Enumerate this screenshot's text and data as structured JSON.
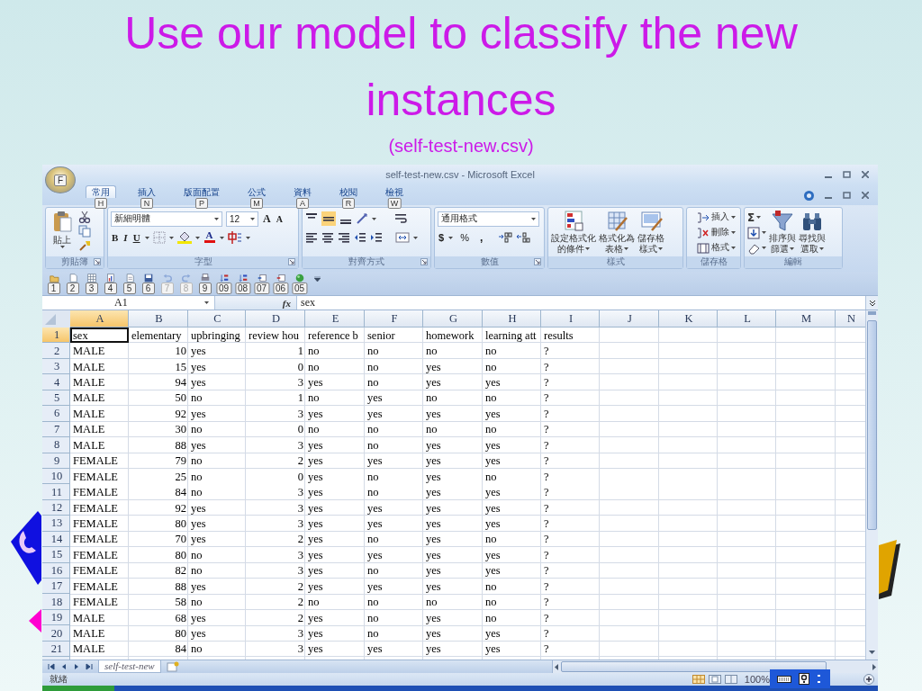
{
  "slide": {
    "title": "Use our model to classify the new instances",
    "subtitle": "(self-test-new.csv)"
  },
  "window": {
    "title": "self-test-new.csv - Microsoft Excel",
    "office_button_keytip": "F"
  },
  "ribbon_tabs": [
    {
      "label": "常用",
      "keytip": "H",
      "selected": true
    },
    {
      "label": "插入",
      "keytip": "N",
      "selected": false
    },
    {
      "label": "版面配置",
      "keytip": "P",
      "selected": false
    },
    {
      "label": "公式",
      "keytip": "M",
      "selected": false
    },
    {
      "label": "資料",
      "keytip": "A",
      "selected": false
    },
    {
      "label": "校閱",
      "keytip": "R",
      "selected": false
    },
    {
      "label": "檢視",
      "keytip": "W",
      "selected": false
    }
  ],
  "ribbon": {
    "clipboard": {
      "label": "剪貼簿",
      "paste": "貼上"
    },
    "font": {
      "label": "字型",
      "font_name": "新細明體",
      "font_size": "12",
      "grow": "A",
      "shrink": "A",
      "bold": "B",
      "italic": "I",
      "underline": "U",
      "font_color": "A"
    },
    "alignment": {
      "label": "對齊方式"
    },
    "number": {
      "label": "數值",
      "format": "通用格式",
      "currency": "$",
      "percent": "%",
      "comma": ","
    },
    "styles": {
      "label": "樣式",
      "buttons": [
        [
          "設定格式化",
          "的條件"
        ],
        [
          "格式化為",
          "表格"
        ],
        [
          "儲存格",
          "樣式"
        ]
      ]
    },
    "cells": {
      "label": "儲存格",
      "buttons": [
        "插入",
        "刪除",
        "格式"
      ]
    },
    "editing": {
      "label": "編輯",
      "sum": "Σ",
      "buttons": [
        [
          "排序與",
          "篩選"
        ],
        [
          "尋找與",
          "選取"
        ]
      ]
    }
  },
  "quick_access": [
    {
      "keytip": "1",
      "disabled": false
    },
    {
      "keytip": "2",
      "disabled": false
    },
    {
      "keytip": "3",
      "disabled": false
    },
    {
      "keytip": "4",
      "disabled": false
    },
    {
      "keytip": "5",
      "disabled": false
    },
    {
      "keytip": "6",
      "disabled": false
    },
    {
      "keytip": "7",
      "disabled": true
    },
    {
      "keytip": "8",
      "disabled": true
    },
    {
      "keytip": "9",
      "disabled": false
    },
    {
      "keytip": "09",
      "disabled": false
    },
    {
      "keytip": "08",
      "disabled": false
    },
    {
      "keytip": "07",
      "disabled": false
    },
    {
      "keytip": "06",
      "disabled": false
    },
    {
      "keytip": "05",
      "disabled": false
    }
  ],
  "formula_bar": {
    "name_box": "A1",
    "function_label": "fx",
    "value": "sex"
  },
  "sheet": {
    "columns": [
      {
        "label": "A",
        "selected": true
      },
      {
        "label": "B",
        "selected": false
      },
      {
        "label": "C",
        "selected": false
      },
      {
        "label": "D",
        "selected": false
      },
      {
        "label": "E",
        "selected": false
      },
      {
        "label": "F",
        "selected": false
      },
      {
        "label": "G",
        "selected": false
      },
      {
        "label": "H",
        "selected": false
      },
      {
        "label": "I",
        "selected": false
      },
      {
        "label": "J",
        "selected": false
      },
      {
        "label": "K",
        "selected": false
      },
      {
        "label": "L",
        "selected": false
      },
      {
        "label": "M",
        "selected": false
      },
      {
        "label": "N",
        "selected": false
      }
    ],
    "rows": [
      {
        "number": "1",
        "selected": true,
        "cells": [
          "sex",
          "elementary",
          "upbringing",
          "review hou",
          "reference b",
          "senior",
          "homework",
          "learning att",
          "results"
        ]
      },
      {
        "number": "2",
        "selected": false,
        "cells": [
          "MALE",
          "10",
          "yes",
          "1",
          "no",
          "no",
          "no",
          "no",
          "?"
        ]
      },
      {
        "number": "3",
        "selected": false,
        "cells": [
          "MALE",
          "15",
          "yes",
          "0",
          "no",
          "no",
          "yes",
          "no",
          "?"
        ]
      },
      {
        "number": "4",
        "selected": false,
        "cells": [
          "MALE",
          "94",
          "yes",
          "3",
          "yes",
          "no",
          "yes",
          "yes",
          "?"
        ]
      },
      {
        "number": "5",
        "selected": false,
        "cells": [
          "MALE",
          "50",
          "no",
          "1",
          "no",
          "yes",
          "no",
          "no",
          "?"
        ]
      },
      {
        "number": "6",
        "selected": false,
        "cells": [
          "MALE",
          "92",
          "yes",
          "3",
          "yes",
          "yes",
          "yes",
          "yes",
          "?"
        ]
      },
      {
        "number": "7",
        "selected": false,
        "cells": [
          "MALE",
          "30",
          "no",
          "0",
          "no",
          "no",
          "no",
          "no",
          "?"
        ]
      },
      {
        "number": "8",
        "selected": false,
        "cells": [
          "MALE",
          "88",
          "yes",
          "3",
          "yes",
          "no",
          "yes",
          "yes",
          "?"
        ]
      },
      {
        "number": "9",
        "selected": false,
        "cells": [
          "FEMALE",
          "79",
          "no",
          "2",
          "yes",
          "yes",
          "yes",
          "yes",
          "?"
        ]
      },
      {
        "number": "10",
        "selected": false,
        "cells": [
          "FEMALE",
          "25",
          "no",
          "0",
          "yes",
          "no",
          "yes",
          "no",
          "?"
        ]
      },
      {
        "number": "11",
        "selected": false,
        "cells": [
          "FEMALE",
          "84",
          "no",
          "3",
          "yes",
          "no",
          "yes",
          "yes",
          "?"
        ]
      },
      {
        "number": "12",
        "selected": false,
        "cells": [
          "FEMALE",
          "92",
          "yes",
          "3",
          "yes",
          "yes",
          "yes",
          "yes",
          "?"
        ]
      },
      {
        "number": "13",
        "selected": false,
        "cells": [
          "FEMALE",
          "80",
          "yes",
          "3",
          "yes",
          "yes",
          "yes",
          "yes",
          "?"
        ]
      },
      {
        "number": "14",
        "selected": false,
        "cells": [
          "FEMALE",
          "70",
          "yes",
          "2",
          "yes",
          "no",
          "yes",
          "no",
          "?"
        ]
      },
      {
        "number": "15",
        "selected": false,
        "cells": [
          "FEMALE",
          "80",
          "no",
          "3",
          "yes",
          "yes",
          "yes",
          "yes",
          "?"
        ]
      },
      {
        "number": "16",
        "selected": false,
        "cells": [
          "FEMALE",
          "82",
          "no",
          "3",
          "yes",
          "no",
          "yes",
          "yes",
          "?"
        ]
      },
      {
        "number": "17",
        "selected": false,
        "cells": [
          "FEMALE",
          "88",
          "yes",
          "2",
          "yes",
          "yes",
          "yes",
          "no",
          "?"
        ]
      },
      {
        "number": "18",
        "selected": false,
        "cells": [
          "FEMALE",
          "58",
          "no",
          "2",
          "no",
          "no",
          "no",
          "no",
          "?"
        ]
      },
      {
        "number": "19",
        "selected": false,
        "cells": [
          "MALE",
          "68",
          "yes",
          "2",
          "yes",
          "no",
          "yes",
          "no",
          "?"
        ]
      },
      {
        "number": "20",
        "selected": false,
        "cells": [
          "MALE",
          "80",
          "yes",
          "3",
          "yes",
          "no",
          "yes",
          "yes",
          "?"
        ]
      },
      {
        "number": "21",
        "selected": false,
        "cells": [
          "MALE",
          "84",
          "no",
          "3",
          "yes",
          "yes",
          "yes",
          "yes",
          "?"
        ]
      }
    ]
  },
  "sheet_tabs": [
    {
      "label": "self-test-new",
      "selected": true
    }
  ],
  "status_bar": {
    "status": "就緒",
    "zoom": "100%"
  }
}
